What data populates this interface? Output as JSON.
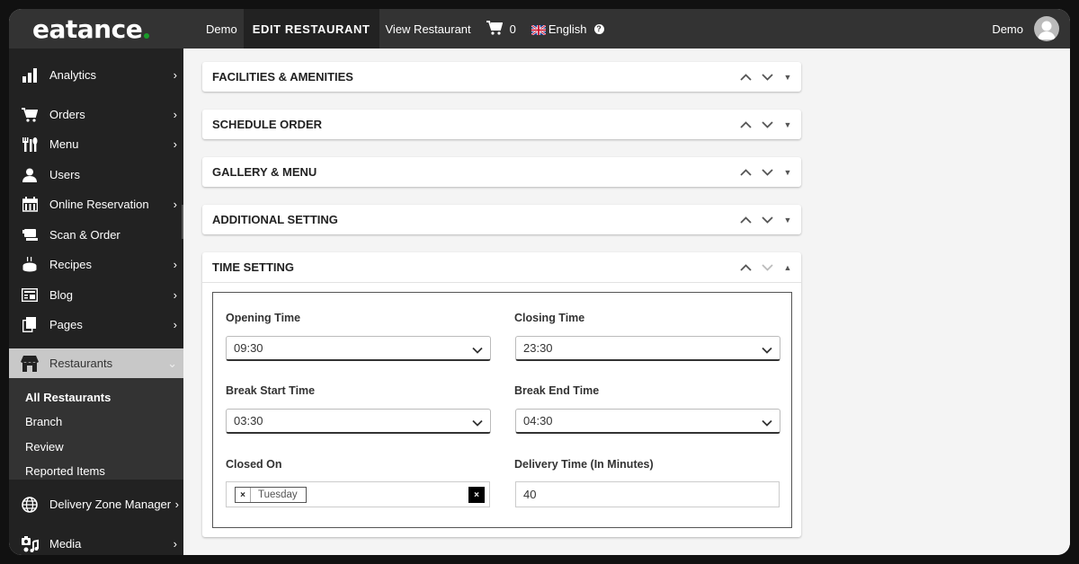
{
  "header": {
    "logo": "eatance",
    "nav": [
      {
        "label": "Demo"
      },
      {
        "label": "EDIT RESTAURANT"
      },
      {
        "label": "View Restaurant"
      }
    ],
    "cart_count": "0",
    "language": "English",
    "user_name": "Demo",
    "icons": {
      "cart": "cart-icon",
      "flag": "uk-flag-icon",
      "help": "help-icon",
      "avatar": "user-avatar-icon"
    }
  },
  "sidebar": {
    "items": [
      {
        "label": "Analytics",
        "icon": "bar-chart-icon",
        "has_children": true
      },
      {
        "label": "Orders",
        "icon": "cart-icon",
        "has_children": true
      },
      {
        "label": "Menu",
        "icon": "utensils-icon",
        "has_children": true
      },
      {
        "label": "Users",
        "icon": "user-icon",
        "has_children": false
      },
      {
        "label": "Online Reservation",
        "icon": "calendar-icon",
        "has_children": true
      },
      {
        "label": "Scan & Order",
        "icon": "scan-icon",
        "has_children": false
      },
      {
        "label": "Recipes",
        "icon": "cake-icon",
        "has_children": true
      },
      {
        "label": "Blog",
        "icon": "blog-icon",
        "has_children": true
      },
      {
        "label": "Pages",
        "icon": "pages-icon",
        "has_children": true
      },
      {
        "label": "Restaurants",
        "icon": "store-icon",
        "has_children": true,
        "expanded": true
      },
      {
        "label": "Delivery Zone Manager",
        "icon": "globe-icon",
        "has_children": true
      },
      {
        "label": "Media",
        "icon": "media-icon",
        "has_children": true
      }
    ],
    "submenu": [
      {
        "label": "All Restaurants",
        "current": true
      },
      {
        "label": "Branch"
      },
      {
        "label": "Review"
      },
      {
        "label": "Reported Items"
      }
    ]
  },
  "main": {
    "panels": [
      {
        "title": "FACILITIES & AMENITIES",
        "collapsed": true
      },
      {
        "title": "SCHEDULE ORDER",
        "collapsed": true
      },
      {
        "title": "GALLERY & MENU",
        "collapsed": true
      },
      {
        "title": "ADDITIONAL SETTING",
        "collapsed": true
      },
      {
        "title": "TIME SETTING",
        "collapsed": false
      }
    ],
    "time_setting": {
      "opening_time": {
        "label": "Opening Time",
        "value": "09:30"
      },
      "closing_time": {
        "label": "Closing Time",
        "value": "23:30"
      },
      "break_start": {
        "label": "Break Start Time",
        "value": "03:30"
      },
      "break_end": {
        "label": "Break End Time",
        "value": "04:30"
      },
      "closed_on": {
        "label": "Closed On",
        "tags": [
          "Tuesday"
        ],
        "tag_remove": "×",
        "clear": "×"
      },
      "delivery_time": {
        "label": "Delivery Time (In Minutes)",
        "value": "40"
      }
    }
  }
}
